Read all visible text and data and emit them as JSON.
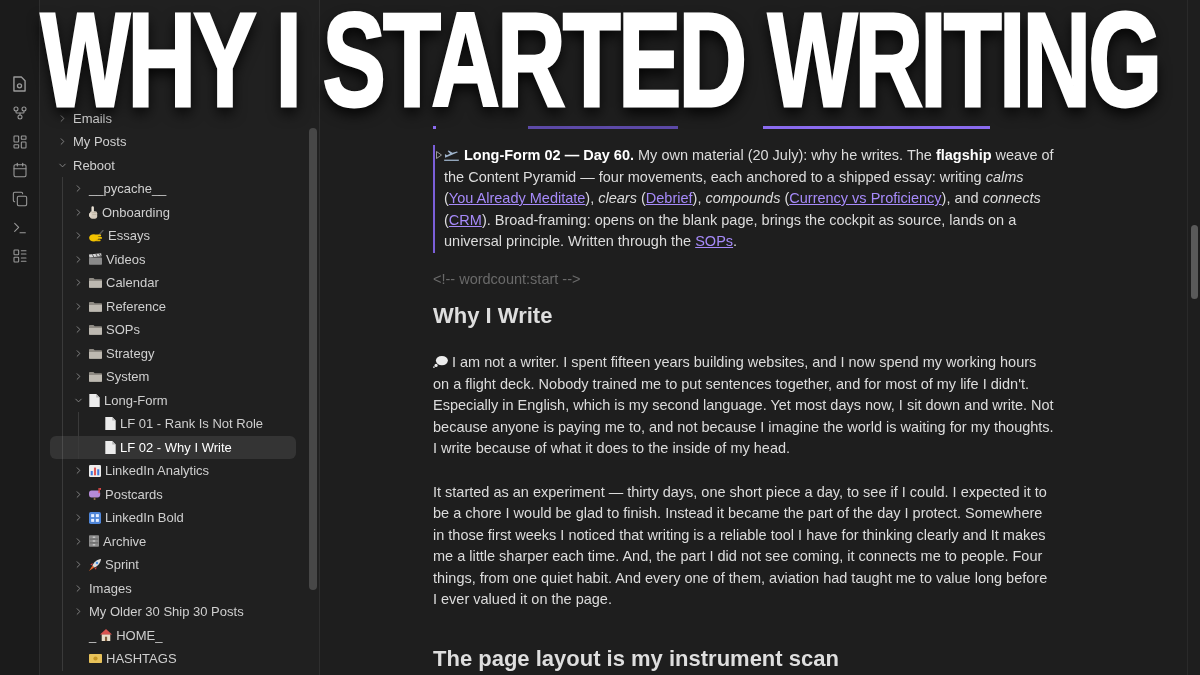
{
  "headline": "WHY I STARTED WRITING",
  "sidebar": {
    "tree": [
      {
        "label": "Emails",
        "kind": "folder",
        "expanded": false,
        "selected": false
      },
      {
        "label": "My Posts",
        "kind": "folder",
        "expanded": false,
        "selected": false
      },
      {
        "label": "Reboot",
        "kind": "folder",
        "expanded": true,
        "selected": false,
        "children": [
          {
            "label": "__pycache__",
            "kind": "folder",
            "expanded": false,
            "selected": false
          },
          {
            "label": "Onboarding",
            "kind": "folder",
            "expanded": false,
            "selected": false
          },
          {
            "label": "Essays",
            "kind": "folder",
            "expanded": false,
            "selected": false
          },
          {
            "label": "Videos",
            "kind": "folder",
            "expanded": false,
            "selected": false
          },
          {
            "label": "Calendar",
            "kind": "folder",
            "expanded": false,
            "selected": false
          },
          {
            "label": "Reference",
            "kind": "folder",
            "expanded": false,
            "selected": false
          },
          {
            "label": "SOPs",
            "kind": "folder",
            "expanded": false,
            "selected": false
          },
          {
            "label": "Strategy",
            "kind": "folder",
            "expanded": false,
            "selected": false
          },
          {
            "label": "System",
            "kind": "folder",
            "expanded": false,
            "selected": false
          },
          {
            "label": "Long-Form",
            "kind": "folder",
            "expanded": true,
            "selected": false,
            "children": [
              {
                "label": "LF 01 - Rank Is Not Role",
                "kind": "file",
                "selected": false
              },
              {
                "label": "LF 02 - Why I Write",
                "kind": "file",
                "selected": true
              }
            ]
          },
          {
            "label": "LinkedIn Analytics",
            "kind": "folder",
            "expanded": false,
            "selected": false
          },
          {
            "label": "Postcards",
            "kind": "folder",
            "expanded": false,
            "selected": false
          },
          {
            "label": "LinkedIn Bold",
            "kind": "folder",
            "expanded": false,
            "selected": false
          },
          {
            "label": "Archive",
            "kind": "folder",
            "expanded": false,
            "selected": false
          },
          {
            "label": "Sprint",
            "kind": "folder",
            "expanded": false,
            "selected": false
          },
          {
            "label": "Images",
            "kind": "folder",
            "expanded": false,
            "selected": false
          },
          {
            "label": "My Older 30 Ship 30 Posts",
            "kind": "folder",
            "expanded": false,
            "selected": false
          },
          {
            "prefix": "_",
            "label": "HOME_",
            "kind": "file",
            "selected": false
          },
          {
            "label": "HASHTAGS",
            "kind": "file",
            "selected": false
          }
        ]
      }
    ]
  },
  "editor": {
    "blocks": [
      {
        "kind": "callout",
        "segments": [
          {
            "kind": "text",
            "text": "**Long-Form 02 — Day 60.** My own material (20 July): why he writes. The **flagship** weave of the Content Pyramid — four movements, each anchored to a shipped essay: writing *calms* ("
          },
          {
            "kind": "link",
            "text": "You Already Meditate"
          },
          {
            "kind": "text",
            "text": "), *clears* ("
          },
          {
            "kind": "link",
            "text": "Debrief"
          },
          {
            "kind": "text",
            "text": "), *compounds* ("
          },
          {
            "kind": "link",
            "text": "Currency vs Proficiency"
          },
          {
            "kind": "text",
            "text": "), and *connects* ("
          },
          {
            "kind": "link",
            "text": "CRM"
          },
          {
            "kind": "text",
            "text": "). Broad-framing: opens on the blank page, brings the cockpit as source, lands on a universal principle. Written through the "
          },
          {
            "kind": "link",
            "text": "SOPs"
          },
          {
            "kind": "text",
            "text": "."
          }
        ]
      },
      {
        "kind": "comment",
        "text": "<!-- wordcount:start -->"
      },
      {
        "kind": "heading",
        "text": "Why I Write"
      },
      {
        "kind": "paragraph",
        "text": "I am not a writer. I spent fifteen years building websites, and I now spend my working hours on a flight deck. Nobody trained me to put sentences together, and for most of my life I didn't. Especially in English, which is my second language. Yet most days now, I sit down and write. Not because anyone is paying me to, and not because I imagine the world is waiting for my thoughts. I write because of what it does to the inside of my head."
      },
      {
        "kind": "paragraph",
        "text": "It started as an experiment — thirty days, one short piece a day, to see if I could. I expected it to be a chore I would be glad to finish. Instead it became the part of the day I protect. Somewhere in those first weeks I noticed that writing is a reliable tool I have for thinking clearly and It makes me a little sharper each time. And, the part I did not see coming, it connects me to people. Four things, from one quiet habit. And every one of them, aviation had taught me to value long before I ever valued it on the page."
      },
      {
        "kind": "heading",
        "text": "The page layout is my instrument scan"
      }
    ]
  }
}
